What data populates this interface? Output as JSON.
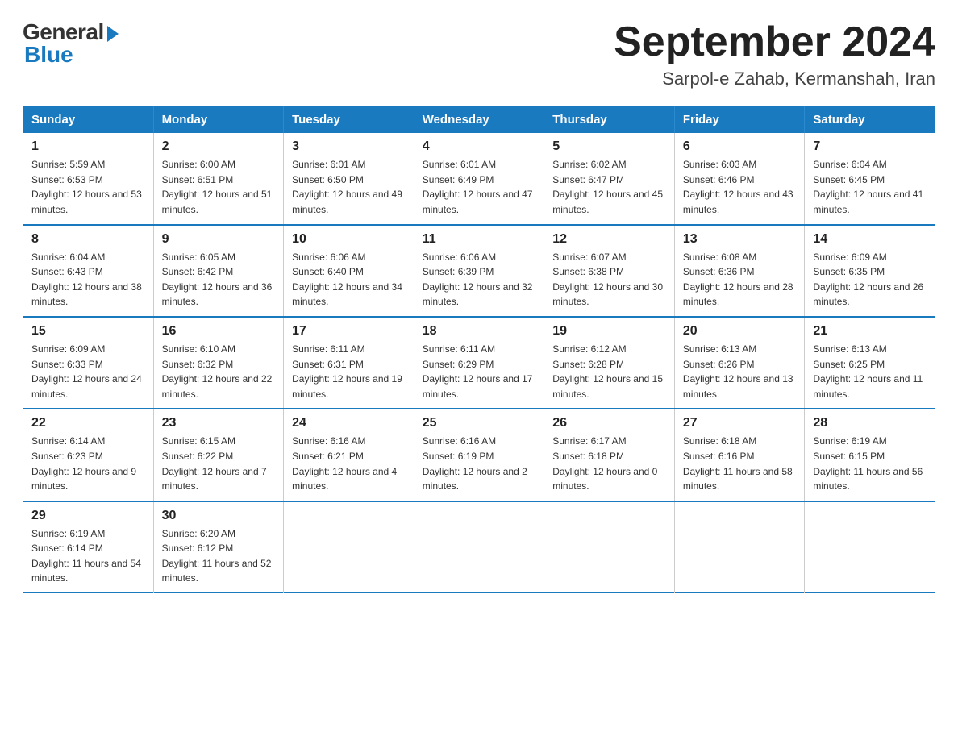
{
  "header": {
    "logo_general": "General",
    "logo_blue": "Blue",
    "title": "September 2024",
    "location": "Sarpol-e Zahab, Kermanshah, Iran"
  },
  "days_of_week": [
    "Sunday",
    "Monday",
    "Tuesday",
    "Wednesday",
    "Thursday",
    "Friday",
    "Saturday"
  ],
  "weeks": [
    [
      {
        "day": "1",
        "sunrise": "5:59 AM",
        "sunset": "6:53 PM",
        "daylight": "12 hours and 53 minutes."
      },
      {
        "day": "2",
        "sunrise": "6:00 AM",
        "sunset": "6:51 PM",
        "daylight": "12 hours and 51 minutes."
      },
      {
        "day": "3",
        "sunrise": "6:01 AM",
        "sunset": "6:50 PM",
        "daylight": "12 hours and 49 minutes."
      },
      {
        "day": "4",
        "sunrise": "6:01 AM",
        "sunset": "6:49 PM",
        "daylight": "12 hours and 47 minutes."
      },
      {
        "day": "5",
        "sunrise": "6:02 AM",
        "sunset": "6:47 PM",
        "daylight": "12 hours and 45 minutes."
      },
      {
        "day": "6",
        "sunrise": "6:03 AM",
        "sunset": "6:46 PM",
        "daylight": "12 hours and 43 minutes."
      },
      {
        "day": "7",
        "sunrise": "6:04 AM",
        "sunset": "6:45 PM",
        "daylight": "12 hours and 41 minutes."
      }
    ],
    [
      {
        "day": "8",
        "sunrise": "6:04 AM",
        "sunset": "6:43 PM",
        "daylight": "12 hours and 38 minutes."
      },
      {
        "day": "9",
        "sunrise": "6:05 AM",
        "sunset": "6:42 PM",
        "daylight": "12 hours and 36 minutes."
      },
      {
        "day": "10",
        "sunrise": "6:06 AM",
        "sunset": "6:40 PM",
        "daylight": "12 hours and 34 minutes."
      },
      {
        "day": "11",
        "sunrise": "6:06 AM",
        "sunset": "6:39 PM",
        "daylight": "12 hours and 32 minutes."
      },
      {
        "day": "12",
        "sunrise": "6:07 AM",
        "sunset": "6:38 PM",
        "daylight": "12 hours and 30 minutes."
      },
      {
        "day": "13",
        "sunrise": "6:08 AM",
        "sunset": "6:36 PM",
        "daylight": "12 hours and 28 minutes."
      },
      {
        "day": "14",
        "sunrise": "6:09 AM",
        "sunset": "6:35 PM",
        "daylight": "12 hours and 26 minutes."
      }
    ],
    [
      {
        "day": "15",
        "sunrise": "6:09 AM",
        "sunset": "6:33 PM",
        "daylight": "12 hours and 24 minutes."
      },
      {
        "day": "16",
        "sunrise": "6:10 AM",
        "sunset": "6:32 PM",
        "daylight": "12 hours and 22 minutes."
      },
      {
        "day": "17",
        "sunrise": "6:11 AM",
        "sunset": "6:31 PM",
        "daylight": "12 hours and 19 minutes."
      },
      {
        "day": "18",
        "sunrise": "6:11 AM",
        "sunset": "6:29 PM",
        "daylight": "12 hours and 17 minutes."
      },
      {
        "day": "19",
        "sunrise": "6:12 AM",
        "sunset": "6:28 PM",
        "daylight": "12 hours and 15 minutes."
      },
      {
        "day": "20",
        "sunrise": "6:13 AM",
        "sunset": "6:26 PM",
        "daylight": "12 hours and 13 minutes."
      },
      {
        "day": "21",
        "sunrise": "6:13 AM",
        "sunset": "6:25 PM",
        "daylight": "12 hours and 11 minutes."
      }
    ],
    [
      {
        "day": "22",
        "sunrise": "6:14 AM",
        "sunset": "6:23 PM",
        "daylight": "12 hours and 9 minutes."
      },
      {
        "day": "23",
        "sunrise": "6:15 AM",
        "sunset": "6:22 PM",
        "daylight": "12 hours and 7 minutes."
      },
      {
        "day": "24",
        "sunrise": "6:16 AM",
        "sunset": "6:21 PM",
        "daylight": "12 hours and 4 minutes."
      },
      {
        "day": "25",
        "sunrise": "6:16 AM",
        "sunset": "6:19 PM",
        "daylight": "12 hours and 2 minutes."
      },
      {
        "day": "26",
        "sunrise": "6:17 AM",
        "sunset": "6:18 PM",
        "daylight": "12 hours and 0 minutes."
      },
      {
        "day": "27",
        "sunrise": "6:18 AM",
        "sunset": "6:16 PM",
        "daylight": "11 hours and 58 minutes."
      },
      {
        "day": "28",
        "sunrise": "6:19 AM",
        "sunset": "6:15 PM",
        "daylight": "11 hours and 56 minutes."
      }
    ],
    [
      {
        "day": "29",
        "sunrise": "6:19 AM",
        "sunset": "6:14 PM",
        "daylight": "11 hours and 54 minutes."
      },
      {
        "day": "30",
        "sunrise": "6:20 AM",
        "sunset": "6:12 PM",
        "daylight": "11 hours and 52 minutes."
      },
      null,
      null,
      null,
      null,
      null
    ]
  ]
}
